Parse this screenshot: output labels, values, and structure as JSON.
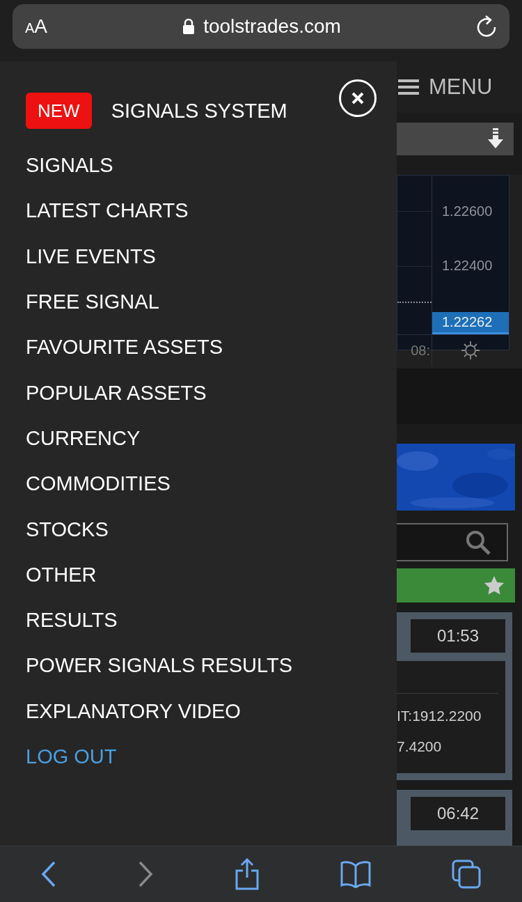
{
  "address_bar": {
    "text_size_letters": [
      "A",
      "A"
    ],
    "url": "toolstrades.com"
  },
  "menu_drawer": {
    "items": [
      {
        "label": "SIGNALS SYSTEM",
        "kind": "new",
        "badge": "NEW"
      },
      {
        "label": "SIGNALS",
        "kind": "link"
      },
      {
        "label": "LATEST CHARTS",
        "kind": "link"
      },
      {
        "label": "LIVE EVENTS",
        "kind": "link"
      },
      {
        "label": "FREE SIGNAL",
        "kind": "link"
      },
      {
        "label": "FAVOURITE ASSETS",
        "kind": "link"
      },
      {
        "label": "POPULAR ASSETS",
        "kind": "link"
      },
      {
        "label": "CURRENCY",
        "kind": "link"
      },
      {
        "label": "COMMODITIES",
        "kind": "link"
      },
      {
        "label": "STOCKS",
        "kind": "link"
      },
      {
        "label": "OTHER",
        "kind": "link"
      },
      {
        "label": "RESULTS",
        "kind": "link"
      },
      {
        "label": "POWER SIGNALS RESULTS",
        "kind": "link"
      },
      {
        "label": "EXPLANATORY VIDEO",
        "kind": "link"
      },
      {
        "label": "LOG OUT",
        "kind": "logout"
      }
    ]
  },
  "background_page": {
    "menu_label": "MENU",
    "price_labels": [
      "1.22600",
      "1.22400"
    ],
    "current_price": "1.22262",
    "time_label": "08:",
    "signal_cards": [
      {
        "time": "01:53",
        "lines": [
          "IT:1912.2200",
          "7.4200"
        ]
      },
      {
        "time": "06:42"
      }
    ]
  },
  "toolbar": {
    "back_disabled": false,
    "forward_disabled": true
  }
}
